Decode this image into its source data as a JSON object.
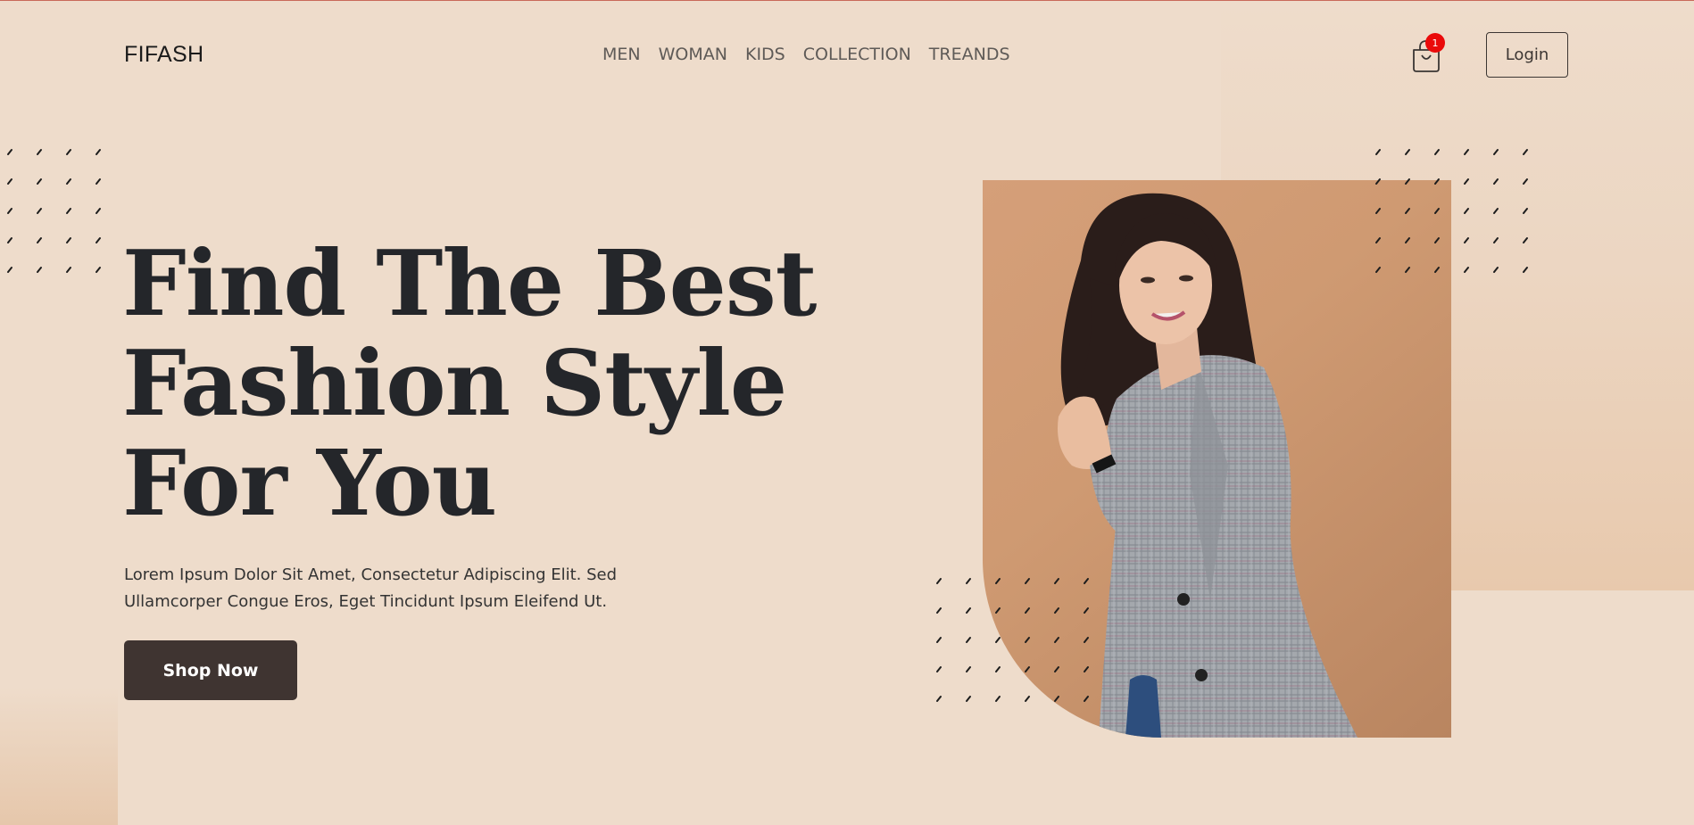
{
  "brand": {
    "logo": "FIFASH"
  },
  "nav": {
    "items": [
      {
        "label": "MEN"
      },
      {
        "label": "WOMAN"
      },
      {
        "label": "KIDS"
      },
      {
        "label": "COLLECTION"
      },
      {
        "label": "TREANDS"
      }
    ]
  },
  "cart": {
    "count": "1"
  },
  "header": {
    "login_label": "Login"
  },
  "hero": {
    "headline_lines": [
      "Find The Best",
      "Fashion Style",
      "For You"
    ],
    "description_lines": [
      "Lorem Ipsum Dolor Sit Amet, Consectetur Adipiscing Elit. Sed",
      "Ullamcorper Congue Eros, Eget Tincidunt Ipsum Eleifend Ut."
    ],
    "cta_label": "Shop Now"
  },
  "colors": {
    "background": "#eedccb",
    "text_dark": "#24262a",
    "button_dark": "#3f3431",
    "badge_red": "#ea0a0a",
    "photo_backdrop": "#d59f79"
  }
}
